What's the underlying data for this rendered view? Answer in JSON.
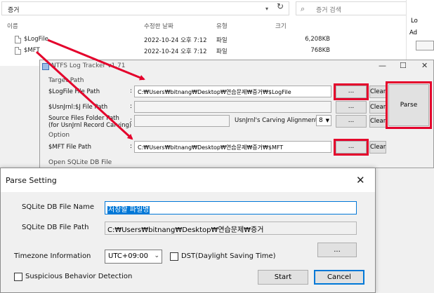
{
  "explorer": {
    "address": "증거",
    "search_placeholder": "증거 검색",
    "columns": {
      "name": "이름",
      "date": "수정한 날짜",
      "type": "유형",
      "size": "크기"
    },
    "files": [
      {
        "name": "$LogFile",
        "date": "2022-10-24 오후 7:12",
        "type": "파일",
        "size": "6,208KB"
      },
      {
        "name": "$MFT",
        "date": "2022-10-24 오후 7:12",
        "type": "파일",
        "size": "768KB"
      }
    ],
    "right_pane": {
      "lo": "Lo",
      "ad": "Ad"
    }
  },
  "tracker": {
    "title": "NTFS Log Tracker v1.71",
    "controls": {
      "minimize": "—",
      "maximize": "☐",
      "close": "✕"
    },
    "groups": {
      "target_path": "Target Path",
      "option": "Option",
      "open_db": "Open SQLite DB File"
    },
    "rows": {
      "logfile": {
        "label": "$LogFile File Path",
        "value": "C:₩Users₩bitnang₩Desktop₩연습문제₩증거₩$LogFile"
      },
      "usnjrnl": {
        "label": "$UsnJrnl:$J File Path",
        "value": ""
      },
      "source": {
        "label_line1": "Source Files Folder Path",
        "label_line2": "(for UsnJrnl Record Carving)",
        "value": ""
      },
      "mft": {
        "label": "$MFT File Path",
        "value": "C:₩Users₩bitnang₩Desktop₩연습문제₩증거₩$MFT"
      }
    },
    "colon": ":",
    "browse_label": "...",
    "clear_label": "Clear",
    "parse_label": "Parse",
    "carving_label": "UsnJrnl's Carving Alignment :",
    "carving_value": "8"
  },
  "dialog": {
    "title": "Parse Setting",
    "close_label": "✕",
    "db_name_label": "SQLite DB File Name",
    "db_name_value": "저장할 파일명",
    "db_path_label": "SQLite DB File Path",
    "db_path_value": "C:₩Users₩bitnang₩Desktop₩연습문제₩증거",
    "timezone_label": "Timezone Information",
    "timezone_value": "UTC+09:00",
    "dst_label": "DST(Daylight Saving Time)",
    "browse_label": "...",
    "suspicious_label": "Suspicious Behavior Detection",
    "start_label": "Start",
    "cancel_label": "Cancel"
  },
  "colors": {
    "highlight": "#e4002b",
    "selection": "#0078d7"
  }
}
